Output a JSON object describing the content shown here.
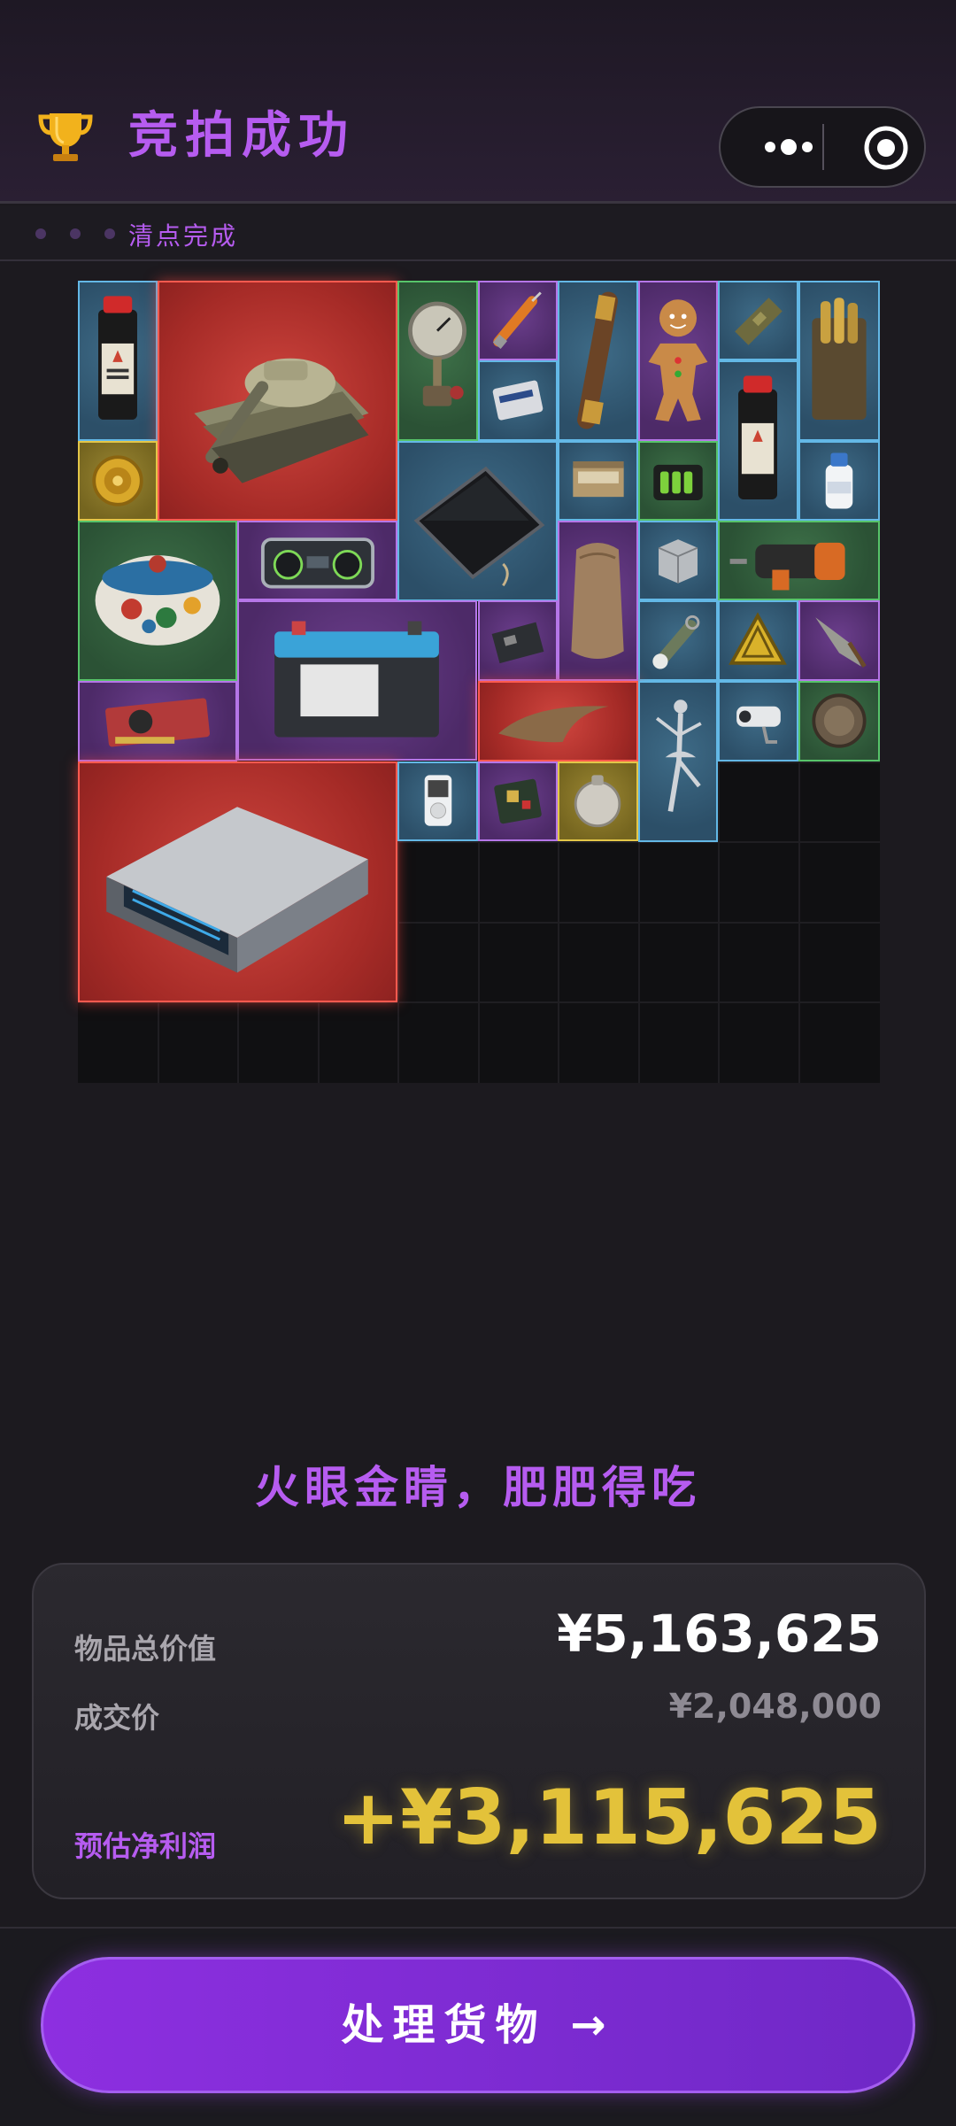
{
  "header": {
    "title": "竞拍成功",
    "subtitle": "清点完成"
  },
  "slogan": "火眼金睛，肥肥得吃",
  "summary": {
    "total_label": "物品总价值",
    "total_value": "¥5,163,625",
    "deal_label": "成交价",
    "deal_value": "¥2,048,000",
    "profit_label": "预估净利润",
    "profit_value": "+¥3,115,625"
  },
  "cta": {
    "label": "处理货物 →"
  },
  "items": [
    {
      "name": "black-powder-bottle",
      "rarity": "blue"
    },
    {
      "name": "tank",
      "rarity": "red"
    },
    {
      "name": "pressure-gauge",
      "rarity": "green"
    },
    {
      "name": "syringe",
      "rarity": "purple"
    },
    {
      "name": "brass-telescope",
      "rarity": "blue"
    },
    {
      "name": "gingerbread-man",
      "rarity": "purple"
    },
    {
      "name": "ration-pack",
      "rarity": "blue"
    },
    {
      "name": "ammo-case",
      "rarity": "blue"
    },
    {
      "name": "memory-card",
      "rarity": "purple"
    },
    {
      "name": "gold-medallion",
      "rarity": "gold"
    },
    {
      "name": "tablet",
      "rarity": "blue"
    },
    {
      "name": "cigarette-box",
      "rarity": "blue"
    },
    {
      "name": "battery-pack",
      "rarity": "green"
    },
    {
      "name": "black-powder-bottle",
      "rarity": "blue"
    },
    {
      "name": "medicine-bottle",
      "rarity": "blue"
    },
    {
      "name": "ceramic-pot",
      "rarity": "green"
    },
    {
      "name": "boombox",
      "rarity": "purple"
    },
    {
      "name": "sack",
      "rarity": "purple"
    },
    {
      "name": "water-tank",
      "rarity": "blue"
    },
    {
      "name": "power-drill",
      "rarity": "green"
    },
    {
      "name": "car-battery",
      "rarity": "purple"
    },
    {
      "name": "circuit-board",
      "rarity": "purple"
    },
    {
      "name": "flashlight",
      "rarity": "blue"
    },
    {
      "name": "warning-sign",
      "rarity": "blue"
    },
    {
      "name": "spearhead",
      "rarity": "purple"
    },
    {
      "name": "graphics-card",
      "rarity": "purple"
    },
    {
      "name": "dinosaur-claw",
      "rarity": "red"
    },
    {
      "name": "ballerina-statue",
      "rarity": "blue"
    },
    {
      "name": "security-camera",
      "rarity": "blue"
    },
    {
      "name": "bronze-coin",
      "rarity": "green"
    },
    {
      "name": "server-unit",
      "rarity": "red"
    },
    {
      "name": "mp3-player",
      "rarity": "blue"
    },
    {
      "name": "chip-board",
      "rarity": "purple"
    },
    {
      "name": "pocket-device",
      "rarity": "gold"
    }
  ]
}
